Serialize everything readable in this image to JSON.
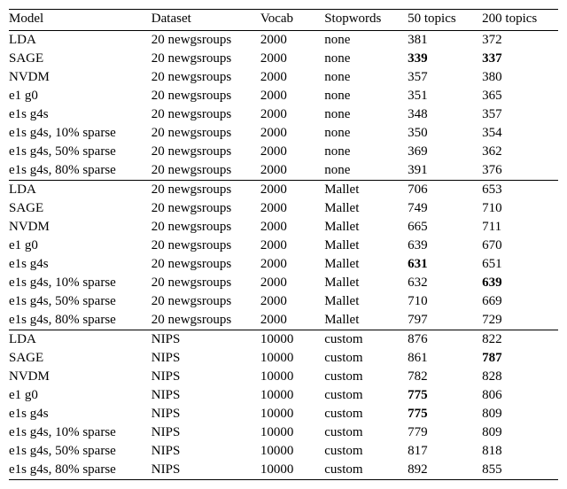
{
  "headers": [
    "Model",
    "Dataset",
    "Vocab",
    "Stopwords",
    "50 topics",
    "200 topics"
  ],
  "chart_data": {
    "type": "table",
    "columns": [
      "Model",
      "Dataset",
      "Vocab",
      "Stopwords",
      "50 topics",
      "200 topics"
    ],
    "groups": [
      {
        "rows": [
          {
            "model": "LDA",
            "dataset": "20 newgsroups",
            "vocab": "2000",
            "stopwords": "none",
            "t50": "381",
            "t200": "372",
            "bold50": false,
            "bold200": false
          },
          {
            "model": "SAGE",
            "dataset": "20 newgsroups",
            "vocab": "2000",
            "stopwords": "none",
            "t50": "339",
            "t200": "337",
            "bold50": true,
            "bold200": true
          },
          {
            "model": "NVDM",
            "dataset": "20 newgsroups",
            "vocab": "2000",
            "stopwords": "none",
            "t50": "357",
            "t200": "380",
            "bold50": false,
            "bold200": false
          },
          {
            "model": "e1 g0",
            "dataset": "20 newgsroups",
            "vocab": "2000",
            "stopwords": "none",
            "t50": "351",
            "t200": "365",
            "bold50": false,
            "bold200": false
          },
          {
            "model": "e1s g4s",
            "dataset": "20 newgsroups",
            "vocab": "2000",
            "stopwords": "none",
            "t50": "348",
            "t200": "357",
            "bold50": false,
            "bold200": false
          },
          {
            "model": "e1s g4s, 10% sparse",
            "dataset": "20 newgsroups",
            "vocab": "2000",
            "stopwords": "none",
            "t50": "350",
            "t200": "354",
            "bold50": false,
            "bold200": false
          },
          {
            "model": "e1s g4s, 50% sparse",
            "dataset": "20 newgsroups",
            "vocab": "2000",
            "stopwords": "none",
            "t50": "369",
            "t200": "362",
            "bold50": false,
            "bold200": false
          },
          {
            "model": "e1s g4s, 80% sparse",
            "dataset": "20 newgsroups",
            "vocab": "2000",
            "stopwords": "none",
            "t50": "391",
            "t200": "376",
            "bold50": false,
            "bold200": false
          }
        ]
      },
      {
        "rows": [
          {
            "model": "LDA",
            "dataset": "20 newgsroups",
            "vocab": "2000",
            "stopwords": "Mallet",
            "t50": "706",
            "t200": "653",
            "bold50": false,
            "bold200": false
          },
          {
            "model": "SAGE",
            "dataset": "20 newgsroups",
            "vocab": "2000",
            "stopwords": "Mallet",
            "t50": "749",
            "t200": "710",
            "bold50": false,
            "bold200": false
          },
          {
            "model": "NVDM",
            "dataset": "20 newgsroups",
            "vocab": "2000",
            "stopwords": "Mallet",
            "t50": "665",
            "t200": "711",
            "bold50": false,
            "bold200": false
          },
          {
            "model": "e1 g0",
            "dataset": "20 newgsroups",
            "vocab": "2000",
            "stopwords": "Mallet",
            "t50": "639",
            "t200": "670",
            "bold50": false,
            "bold200": false
          },
          {
            "model": "e1s g4s",
            "dataset": "20 newgsroups",
            "vocab": "2000",
            "stopwords": "Mallet",
            "t50": "631",
            "t200": "651",
            "bold50": true,
            "bold200": false
          },
          {
            "model": "e1s g4s, 10% sparse",
            "dataset": "20 newgsroups",
            "vocab": "2000",
            "stopwords": "Mallet",
            "t50": "632",
            "t200": "639",
            "bold50": false,
            "bold200": true
          },
          {
            "model": "e1s g4s, 50% sparse",
            "dataset": "20 newgsroups",
            "vocab": "2000",
            "stopwords": "Mallet",
            "t50": "710",
            "t200": "669",
            "bold50": false,
            "bold200": false
          },
          {
            "model": "e1s g4s, 80% sparse",
            "dataset": "20 newgsroups",
            "vocab": "2000",
            "stopwords": "Mallet",
            "t50": "797",
            "t200": "729",
            "bold50": false,
            "bold200": false
          }
        ]
      },
      {
        "rows": [
          {
            "model": "LDA",
            "dataset": "NIPS",
            "vocab": "10000",
            "stopwords": "custom",
            "t50": "876",
            "t200": "822",
            "bold50": false,
            "bold200": false
          },
          {
            "model": "SAGE",
            "dataset": "NIPS",
            "vocab": "10000",
            "stopwords": "custom",
            "t50": "861",
            "t200": "787",
            "bold50": false,
            "bold200": true
          },
          {
            "model": "NVDM",
            "dataset": "NIPS",
            "vocab": "10000",
            "stopwords": "custom",
            "t50": "782",
            "t200": "828",
            "bold50": false,
            "bold200": false
          },
          {
            "model": "e1 g0",
            "dataset": "NIPS",
            "vocab": "10000",
            "stopwords": "custom",
            "t50": "775",
            "t200": "806",
            "bold50": true,
            "bold200": false
          },
          {
            "model": "e1s g4s",
            "dataset": "NIPS",
            "vocab": "10000",
            "stopwords": "custom",
            "t50": "775",
            "t200": "809",
            "bold50": true,
            "bold200": false
          },
          {
            "model": "e1s g4s, 10% sparse",
            "dataset": "NIPS",
            "vocab": "10000",
            "stopwords": "custom",
            "t50": "779",
            "t200": "809",
            "bold50": false,
            "bold200": false
          },
          {
            "model": "e1s g4s, 50% sparse",
            "dataset": "NIPS",
            "vocab": "10000",
            "stopwords": "custom",
            "t50": "817",
            "t200": "818",
            "bold50": false,
            "bold200": false
          },
          {
            "model": "e1s g4s, 80% sparse",
            "dataset": "NIPS",
            "vocab": "10000",
            "stopwords": "custom",
            "t50": "892",
            "t200": "855",
            "bold50": false,
            "bold200": false
          }
        ]
      }
    ]
  }
}
